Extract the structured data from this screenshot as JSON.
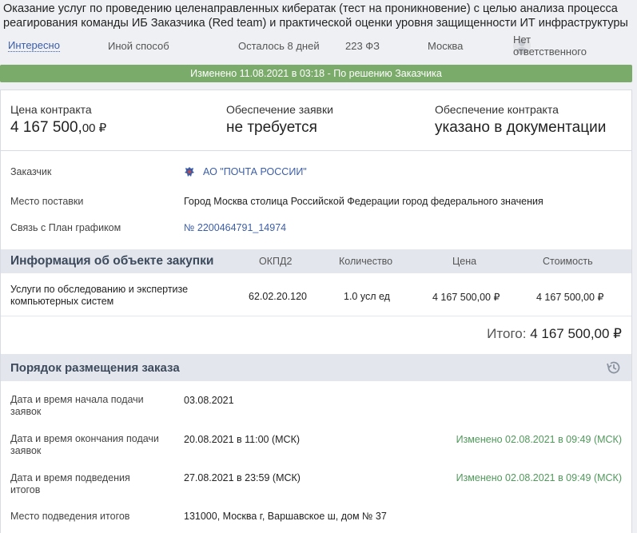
{
  "title": "Оказание услуг по проведению целенаправленных кибератак (тест на проникновение) с целью анализа процесса реагирования команды ИБ Заказчика (Red team) и практической оценки уровня защищенности ИТ инфраструктуры",
  "meta": {
    "interesting": "Интересно",
    "other_method": "Иной способ",
    "remaining": "Осталось 8 дней",
    "law": "223 ФЗ",
    "city": "Москва",
    "responsible": "Нет ответственного"
  },
  "banner": "Изменено 11.08.2021 в 03:18 - По решению Заказчика",
  "prices": {
    "contract_label": "Цена контракта",
    "contract_value": "4 167 500,",
    "contract_cents": "00 ₽",
    "app_security_label": "Обеспечение заявки",
    "app_security_value": "не требуется",
    "contract_security_label": "Обеспечение контракта",
    "contract_security_value": "указано в документации"
  },
  "info": {
    "customer_label": "Заказчик",
    "customer_value": "АО \"ПОЧТА РОССИИ\"",
    "delivery_label": "Место поставки",
    "delivery_value": "Город Москва столица Российской Федерации город федерального значения",
    "plan_label": "Связь с План графиком",
    "plan_value": "№ 2200464791_14974"
  },
  "object": {
    "title": "Информация об объекте закупки",
    "columns": [
      "ОКПД2",
      "Количество",
      "Цена",
      "Стоимость"
    ],
    "row": {
      "name": "Услуги по обследованию и экспертизе компьютерных систем",
      "okpd": "62.02.20.120",
      "qty": "1.0 усл ед",
      "price": "4 167 500,00 ₽",
      "cost": "4 167 500,00 ₽"
    },
    "total_label": "Итого:",
    "total_value": "4 167 500,00 ₽"
  },
  "order": {
    "title": "Порядок размещения заказа",
    "rows": [
      {
        "label": "Дата и время начала подачи заявок",
        "value": "03.08.2021",
        "change": ""
      },
      {
        "label": "Дата и время окончания подачи заявок",
        "value": "20.08.2021 в 11:00 (МСК)",
        "change": "Изменено 02.08.2021 в 09:49 (МСК)"
      },
      {
        "label": "Дата и время подведения итогов",
        "value": "27.08.2021 в 23:59 (МСК)",
        "change": "Изменено 02.08.2021 в 09:49 (МСК)"
      },
      {
        "label": "Место подведения итогов",
        "value": "131000, Москва г, Варшавское ш, дом № 37",
        "change": ""
      }
    ]
  },
  "colors": {
    "banner": "#7aab6a",
    "link": "#3b5da8",
    "changed": "#4f9a5a",
    "section_bg": "#e3e7ed"
  }
}
